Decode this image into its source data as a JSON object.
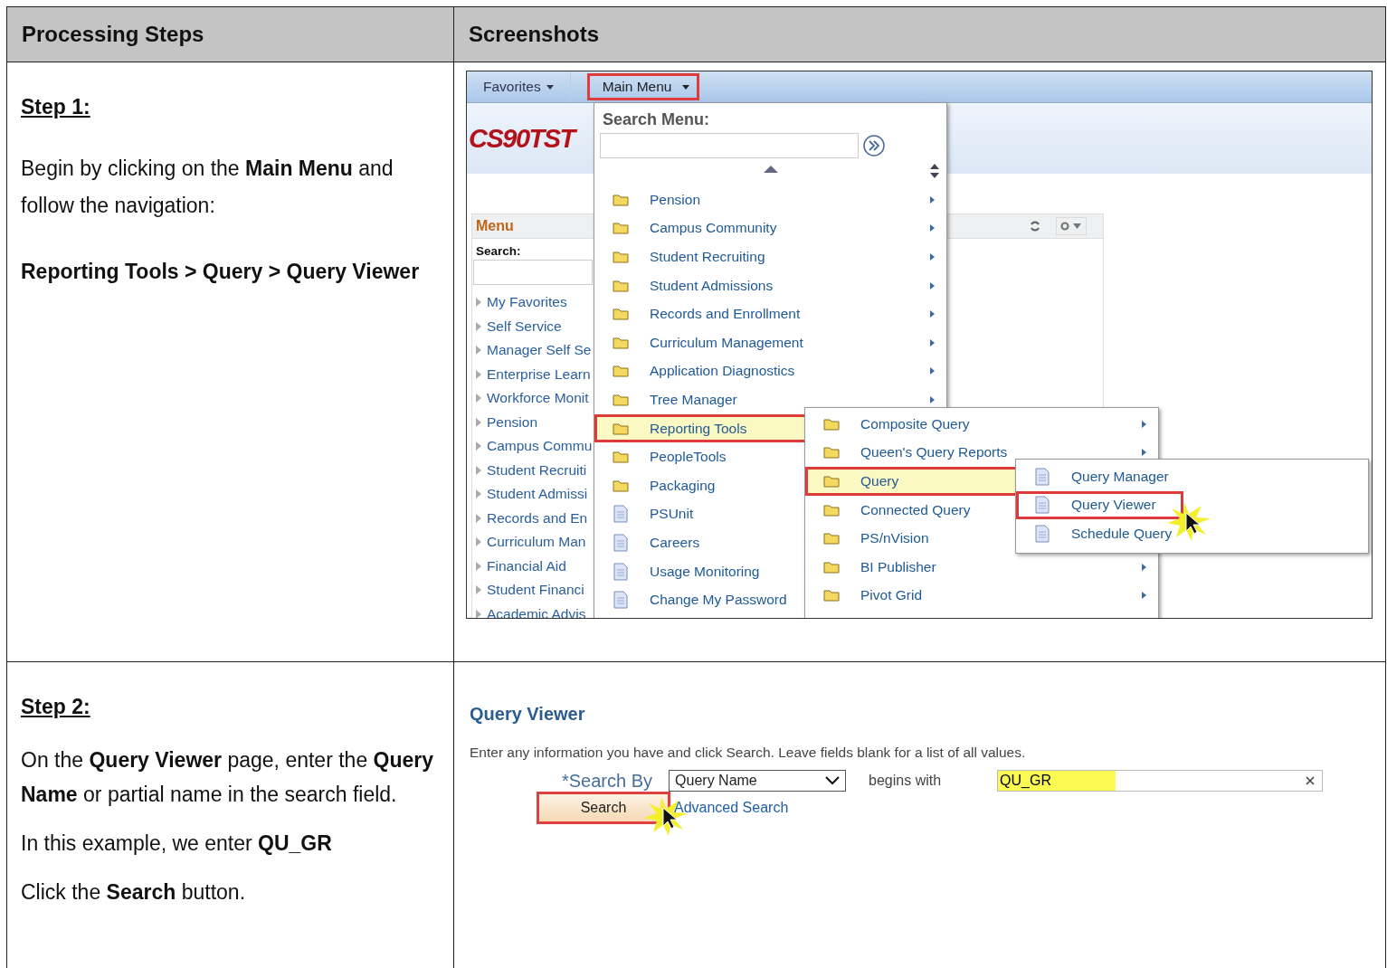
{
  "table": {
    "columns": [
      "Processing Steps",
      "Screenshots"
    ]
  },
  "steps": [
    {
      "heading": "Step 1:",
      "paragraphs": [
        {
          "text": "Begin by clicking on the **Main Menu** and follow the navigation:",
          "bold": false
        },
        {
          "text": "Reporting Tools > Query > Query Viewer",
          "bold": true
        }
      ]
    },
    {
      "heading": "Step 2:",
      "paragraphs": [
        {
          "text": "On the **Query Viewer** page, enter the **Query Name** or partial name in the search field.",
          "bold": false
        },
        {
          "text": "In this example, we enter **QU_GR**",
          "bold": false
        },
        {
          "text": "Click the **Search** button.",
          "bold": false
        }
      ]
    }
  ],
  "screenshot_1": {
    "nav": {
      "favorites": "Favorites",
      "main_menu": "Main Menu",
      "main_menu_highlighted": true
    },
    "logo": "CS90TST",
    "left_menu": {
      "title": "Menu",
      "search_label": "Search:",
      "items": [
        "My Favorites",
        "Self Service",
        "Manager Self Se",
        "Enterprise Learn",
        "Workforce Monit",
        "Pension",
        "Campus Commu",
        "Student Recruiti",
        "Student Admissi",
        "Records and En",
        "Curriculum Man",
        "Financial Aid",
        "Student Financi",
        "Academic Advis"
      ]
    },
    "main_menu": {
      "search_label": "Search Menu:",
      "items": [
        {
          "label": "Pension",
          "kind": "folder",
          "arrow": true,
          "selected": false
        },
        {
          "label": "Campus Community",
          "kind": "folder",
          "arrow": true,
          "selected": false
        },
        {
          "label": "Student Recruiting",
          "kind": "folder",
          "arrow": true,
          "selected": false
        },
        {
          "label": "Student Admissions",
          "kind": "folder",
          "arrow": true,
          "selected": false
        },
        {
          "label": "Records and Enrollment",
          "kind": "folder",
          "arrow": true,
          "selected": false
        },
        {
          "label": "Curriculum Management",
          "kind": "folder",
          "arrow": true,
          "selected": false
        },
        {
          "label": "Application Diagnostics",
          "kind": "folder",
          "arrow": true,
          "selected": false
        },
        {
          "label": "Tree Manager",
          "kind": "folder",
          "arrow": true,
          "selected": false
        },
        {
          "label": "Reporting Tools",
          "kind": "folder",
          "selected": true
        },
        {
          "label": "PeopleTools",
          "kind": "folder",
          "selected": false
        },
        {
          "label": "Packaging",
          "kind": "folder",
          "selected": false
        },
        {
          "label": "PSUnit",
          "kind": "page",
          "selected": false
        },
        {
          "label": "Careers",
          "kind": "page",
          "selected": false
        },
        {
          "label": "Usage Monitoring",
          "kind": "page",
          "selected": false
        },
        {
          "label": "Change My Password",
          "kind": "page",
          "selected": false
        }
      ]
    },
    "reporting_submenu": [
      {
        "label": "Composite Query",
        "kind": "folder",
        "arrow": true,
        "selected": false
      },
      {
        "label": "Queen's Query Reports",
        "kind": "folder",
        "arrow": true,
        "selected": false
      },
      {
        "label": "Query",
        "kind": "folder",
        "selected": true
      },
      {
        "label": "Connected Query",
        "kind": "folder",
        "selected": false
      },
      {
        "label": "PS/nVision",
        "kind": "folder",
        "selected": false
      },
      {
        "label": "BI Publisher",
        "kind": "folder",
        "arrow": true,
        "selected": false
      },
      {
        "label": "Pivot Grid",
        "kind": "folder",
        "arrow": true,
        "selected": false
      }
    ],
    "query_submenu": [
      {
        "label": "Query Manager",
        "kind": "page",
        "selected": false
      },
      {
        "label": "Query Viewer",
        "kind": "page",
        "selected": true
      },
      {
        "label": "Schedule Query",
        "kind": "page",
        "selected": false
      }
    ]
  },
  "screenshot_2": {
    "title": "Query Viewer",
    "instruction": "Enter any information you have and click Search. Leave fields blank for a list of all values.",
    "search_by_label": "*Search By",
    "search_by_value": "Query Name",
    "operator": "begins with",
    "search_value": "QU_GR",
    "search_button": "Search",
    "search_button_highlighted": true,
    "advanced_link": "Advanced Search"
  }
}
